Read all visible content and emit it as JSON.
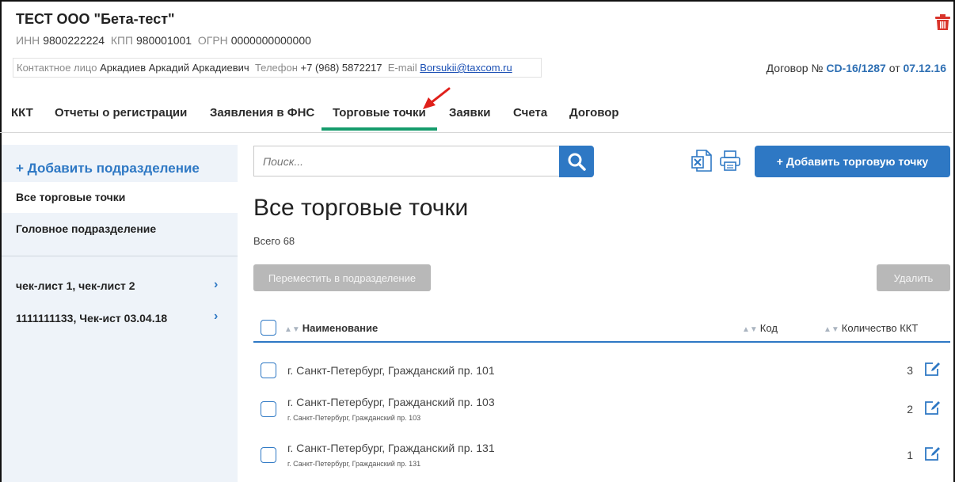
{
  "org": {
    "title": "ТЕСТ ООО \"Бета-тест\"",
    "inn_label": "ИНН",
    "inn": "9800222224",
    "kpp_label": "КПП",
    "kpp": "980001001",
    "ogrn_label": "ОГРН",
    "ogrn": "0000000000000"
  },
  "contact": {
    "person_label": "Контактное лицо",
    "person": "Аркадиев Аркадий Аркадиевич",
    "phone_label": "Телефон",
    "phone": "+7 (968) 5872217",
    "email_label": "E-mail",
    "email": "Borsukii@taxcom.ru"
  },
  "contract": {
    "label": "Договор №",
    "number": "CD-16/1287",
    "from_label": "от",
    "date": "07.12.16"
  },
  "tabs": [
    {
      "label": "ККТ"
    },
    {
      "label": "Отчеты о регистрации"
    },
    {
      "label": "Заявления в ФНС"
    },
    {
      "label": "Торговые точки",
      "active": true
    },
    {
      "label": "Заявки"
    },
    {
      "label": "Счета"
    },
    {
      "label": "Договор"
    }
  ],
  "sidebar": {
    "add_label": "+ Добавить подразделение",
    "all_label": "Все торговые точки",
    "head_label": "Головное подразделение",
    "items": [
      {
        "label": "чек-лист 1, чек-лист 2"
      },
      {
        "label": "1111111133, Чек-ист 03.04.18"
      }
    ]
  },
  "toolbar": {
    "search_placeholder": "Поиск...",
    "add_button": "+ Добавить торговую точку"
  },
  "main": {
    "title": "Все торговые точки",
    "total": "Всего 68",
    "move_button": "Переместить в подразделение",
    "delete_button": "Удалить"
  },
  "table": {
    "columns": [
      "Наименование",
      "Код",
      "Количество ККТ"
    ],
    "rows": [
      {
        "name": "г. Санкт-Петербург, Гражданский пр. 101",
        "sub": "",
        "count": "3"
      },
      {
        "name": "г. Санкт-Петербург, Гражданский пр. 103",
        "sub": "г. Санкт-Петербург, Гражданский пр. 103",
        "count": "2"
      },
      {
        "name": "г. Санкт-Петербург, Гражданский пр. 131",
        "sub": "г. Санкт-Петербург, Гражданский пр. 131",
        "count": "1"
      }
    ]
  },
  "colors": {
    "accent": "#2e78c4",
    "tab_active": "#159c6c",
    "danger": "#d9342b",
    "disabled": "#b8b8b8"
  }
}
